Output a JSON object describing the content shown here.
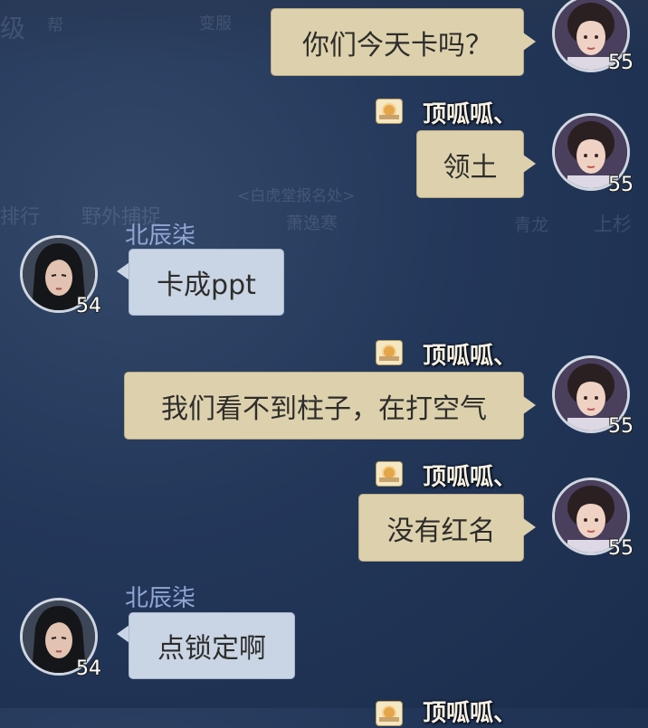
{
  "background_text": {
    "row1": [
      "级",
      "帮",
      "变服"
    ],
    "row2": [
      "排行",
      "野外捕捉",
      "<白虎堂报名处>",
      "萧逸寒",
      "青龙",
      "上杉"
    ]
  },
  "messages": [
    {
      "sender": "",
      "level": "55",
      "text": "你们今天卡吗？",
      "side": "me"
    },
    {
      "sender": "顶呱呱、",
      "level": "55",
      "text": "领土",
      "side": "me"
    },
    {
      "sender": "北辰柒",
      "level": "54",
      "text": "卡成ppt",
      "side": "other"
    },
    {
      "sender": "顶呱呱、",
      "level": "55",
      "text": "我们看不到柱子，在打空气",
      "side": "me"
    },
    {
      "sender": "顶呱呱、",
      "level": "55",
      "text": "没有红名",
      "side": "me"
    },
    {
      "sender": "北辰柒",
      "level": "54",
      "text": "点锁定啊",
      "side": "other"
    },
    {
      "sender": "顶呱呱、",
      "level": "",
      "text": "",
      "side": "me"
    }
  ],
  "colors": {
    "my_bubble": "#ddd1ad",
    "other_bubble": "#c9d5e5",
    "other_name": "#8fa7d2",
    "background": "#23375a"
  },
  "icons": {
    "sender_badge": "sunrise-icon",
    "avatar_female": "female-avatar",
    "avatar_male": "male-avatar"
  }
}
